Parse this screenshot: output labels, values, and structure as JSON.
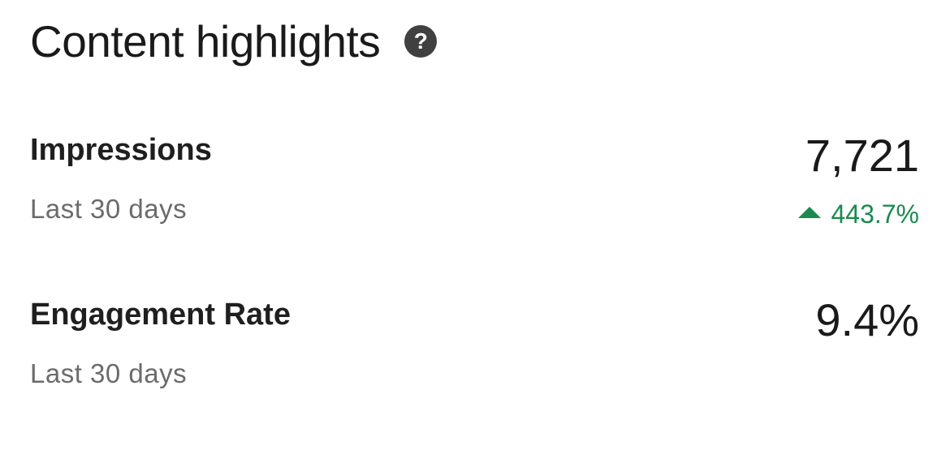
{
  "header": {
    "title": "Content highlights",
    "help_icon": "question-circle-icon"
  },
  "metrics": [
    {
      "label": "Impressions",
      "period": "Last 30 days",
      "value": "7,721",
      "change": "443.7%",
      "change_direction": "up",
      "change_icon": "triangle-up-icon"
    },
    {
      "label": "Engagement Rate",
      "period": "Last 30 days",
      "value": "9.4%"
    }
  ],
  "colors": {
    "positive": "#1b8a4f",
    "secondary_text": "#6b6b6b",
    "help_icon_bg": "#404040"
  }
}
